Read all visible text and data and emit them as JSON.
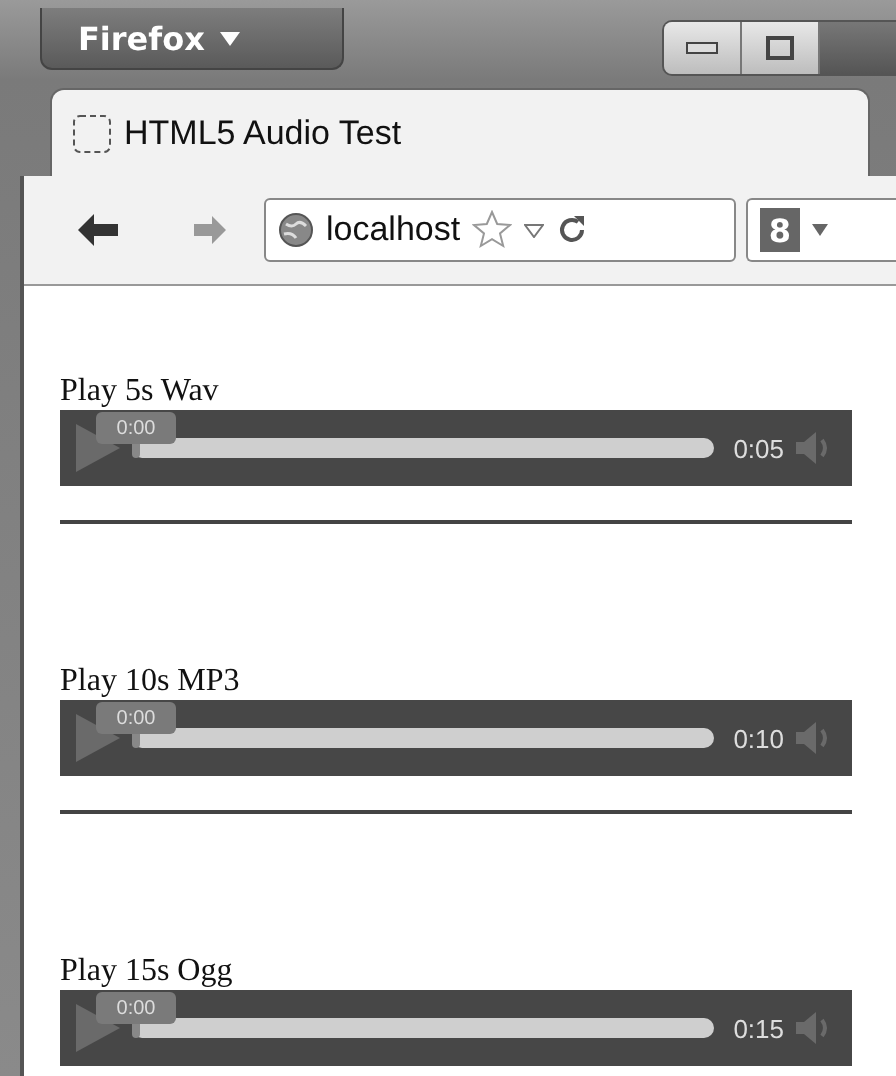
{
  "window": {
    "app_button": "Firefox",
    "tab": {
      "title": "HTML5 Audio Test",
      "selected": true
    },
    "address": "localhost",
    "search_engine_icon": "8"
  },
  "players": [
    {
      "label": "Play 5s Wav",
      "tooltip": "0:00",
      "duration": "0:05",
      "level": 0
    },
    {
      "label": "Play 10s MP3",
      "tooltip": "0:00",
      "duration": "0:10",
      "level": 0
    },
    {
      "label": "Play 15s Ogg",
      "tooltip": "0:00",
      "duration": "0:15",
      "level": 0
    }
  ]
}
